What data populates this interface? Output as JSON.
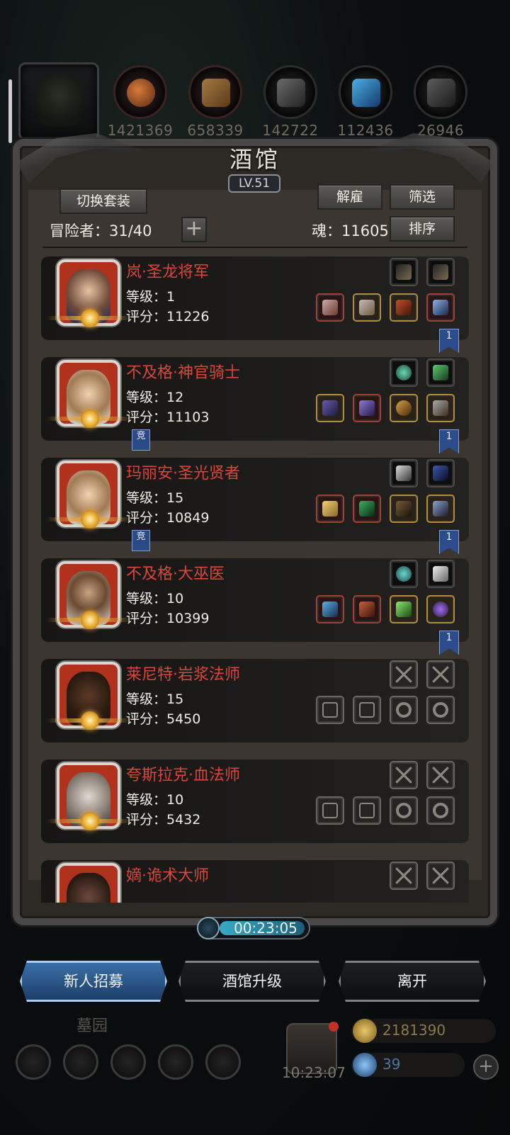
{
  "resources": {
    "values": [
      "1421369",
      "658339",
      "142722",
      "112436",
      "26946"
    ]
  },
  "tavern": {
    "title": "酒馆",
    "level": "LV.51",
    "switch_set_label": "切换套装",
    "dismiss_label": "解雇",
    "filter_label": "筛选",
    "sort_label": "排序",
    "adventurers_label": "冒险者：31/40",
    "plus_label": "+",
    "soul_label": "魂：11605"
  },
  "heroes": [
    {
      "name": "岚·圣龙将军",
      "level": "等级：1",
      "score": "评分：11226",
      "flag": "1",
      "comp": ""
    },
    {
      "name": "不及格·神官骑士",
      "level": "等级：12",
      "score": "评分：11103",
      "flag": "1",
      "comp": "竞"
    },
    {
      "name": "玛丽安·圣光贤者",
      "level": "等级：15",
      "score": "评分：10849",
      "flag": "1",
      "comp": "竞"
    },
    {
      "name": "不及格·大巫医",
      "level": "等级：10",
      "score": "评分：10399",
      "flag": "1",
      "comp": ""
    },
    {
      "name": "莱尼特·岩浆法师",
      "level": "等级：15",
      "score": "评分：5450",
      "flag": "",
      "comp": ""
    },
    {
      "name": "夸斯拉克·血法师",
      "level": "等级：10",
      "score": "评分：5432",
      "flag": "",
      "comp": ""
    },
    {
      "name": "嫡·诡术大师",
      "level": "",
      "score": "",
      "flag": "",
      "comp": ""
    }
  ],
  "timer": "00:23:05",
  "actions": {
    "recruit": "新人招募",
    "upgrade": "酒馆升级",
    "leave": "离开"
  },
  "footer": {
    "title": "墓园",
    "clock": "10:23:07",
    "gold": "2181390",
    "gems": "39",
    "add": "+"
  },
  "colors": {
    "hero_name": "#d9463a",
    "primary_button": "#3a6fa8",
    "flag_blue": "#2c4c8c"
  }
}
